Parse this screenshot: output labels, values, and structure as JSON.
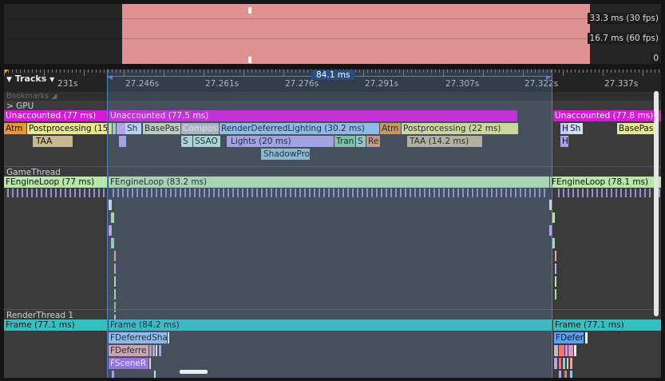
{
  "frames_panel": {
    "labels": [
      "33.3 ms (30 fps)",
      "16.7 ms (60 fps)",
      "0"
    ]
  },
  "toolbar": {
    "tracks_label": "Tracks",
    "selection_duration": "84.1 ms"
  },
  "ruler": {
    "labels": [
      "231s",
      "27.246s",
      "27.261s",
      "27.276s",
      "27.291s",
      "27.307s",
      "27.322s",
      "27.337s"
    ]
  },
  "bookmarks_label": "Bookmarks",
  "tracks": {
    "gpu": {
      "label": "> GPU",
      "row0": [
        "Unaccounted (77 ms)",
        "Unaccounted (77.5 ms)",
        "Unaccounted (77.8 ms)"
      ],
      "row1": [
        "Atm",
        "Postprocessing (15",
        "Sh",
        "BasePas",
        "Composi",
        "RenderDeferredLighting (30.2 ms)",
        "Atm",
        "Postprocessing (22 ms)",
        "H",
        "Sh",
        "BasePas"
      ],
      "row2": [
        "TAA",
        "S",
        "SSAO",
        "Lights (20 ms)",
        "Tran",
        "S",
        "Re",
        "TAA (14.2 ms)",
        "H"
      ],
      "row3": [
        "ShadowProj"
      ]
    },
    "game": {
      "label": "GameThread",
      "row0": [
        "FEngineLoop (77 ms)",
        "FEngineLoop (83.2 ms)",
        "FEngineLoop (78.1 ms)"
      ]
    },
    "render": {
      "label": "RenderThread 1",
      "row0": [
        "Frame (77.1 ms)",
        "Frame (84.2 ms)",
        "Frame (77.1 ms)"
      ],
      "row1": [
        "FDeferredSha",
        "FDefer"
      ],
      "row2": [
        "FDeferre"
      ],
      "row3": [
        "FSceneR"
      ]
    }
  },
  "colors": {
    "unaccounted": "#e014e0",
    "atm": "#e89a2e",
    "postprocessing": "#e8e888",
    "taa": "#c9b78f",
    "lighting": "#97c5ef",
    "lights": "#b2a6ea",
    "engine_loop": "#b6e8a8",
    "frame": "#35c0c0",
    "selection": "#5a7fbf",
    "frame_spike": "#e09191"
  }
}
